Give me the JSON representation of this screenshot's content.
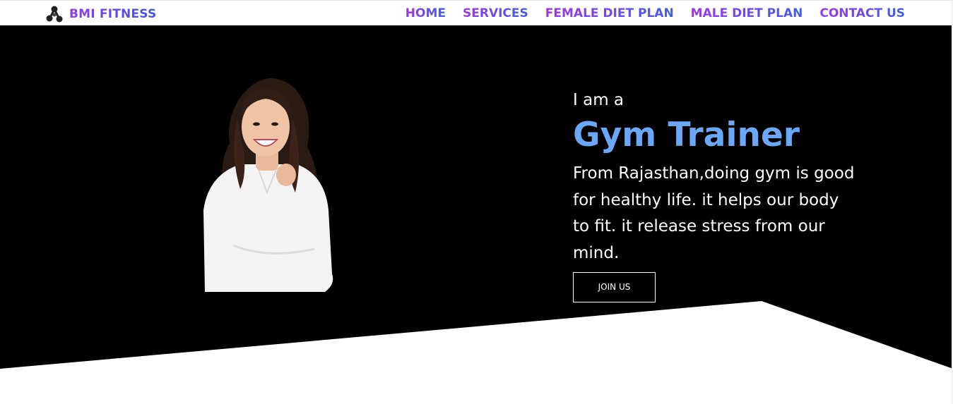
{
  "header": {
    "brand_icon": "dumbbell-molecule-icon",
    "brand_name": "BMI FITNESS",
    "nav": [
      {
        "label": "HOME"
      },
      {
        "label": "SERVICES"
      },
      {
        "label": "FEMALE DIET PLAN"
      },
      {
        "label": "MALE DIET PLAN"
      },
      {
        "label": "CONTACT US"
      }
    ],
    "gradient_colors": [
      "#8d3de6",
      "#3f56e6"
    ]
  },
  "hero": {
    "intro": "I am a",
    "headline": "Gym Trainer",
    "description": "From Rajasthan,doing gym is good for healthy life. it helps our body to fit. it release stress from our mind.",
    "button_label": "JOIN US",
    "portrait": "smiling-woman-portrait",
    "colors": {
      "background": "#000000",
      "headline": "#6aa8f7",
      "text": "#ffffff"
    }
  }
}
